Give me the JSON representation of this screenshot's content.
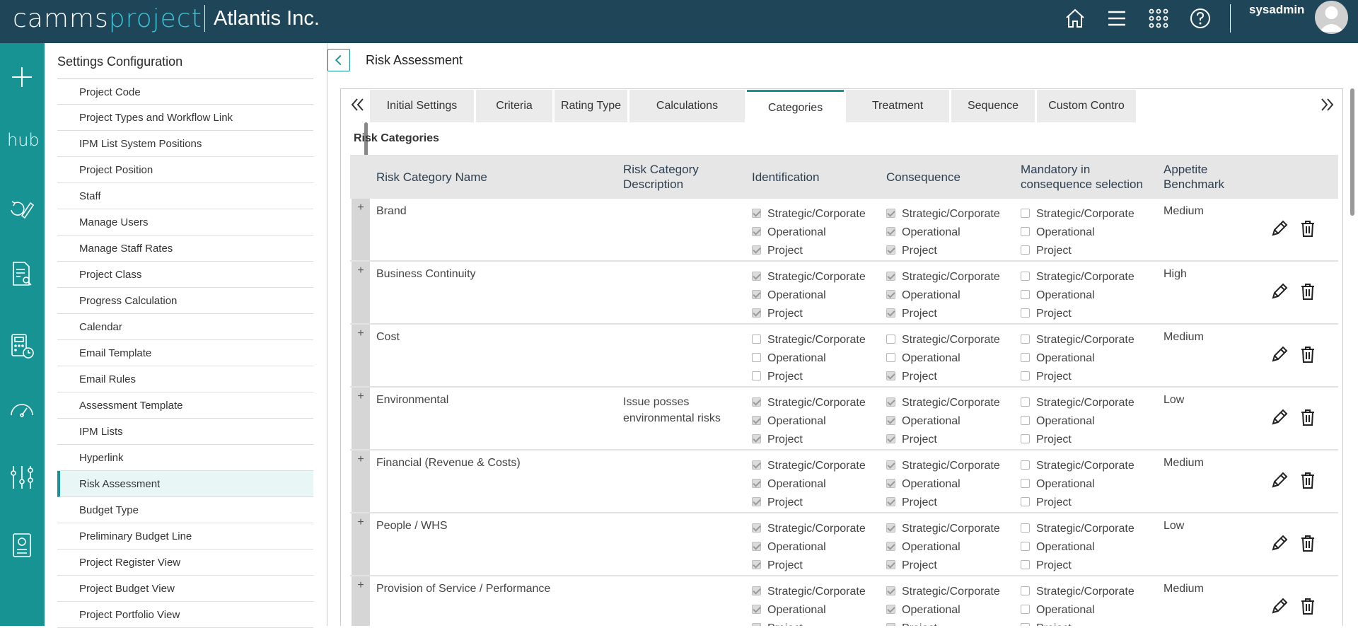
{
  "header": {
    "brand_part1": "camms",
    "brand_part2": "project",
    "company": "Atlantis Inc.",
    "username": "sysadmin",
    "icons": [
      "home-icon",
      "menu-icon",
      "apps-grid-icon",
      "help-icon"
    ]
  },
  "leftnav": {
    "items": [
      "add-icon",
      "hub-icon",
      "refresh-edit-icon",
      "document-search-icon",
      "calculator-clock-icon",
      "dashboard-gauge-icon",
      "settings-sliders-icon",
      "report-icon"
    ],
    "hub_label": "hub"
  },
  "settings": {
    "title": "Settings Configuration",
    "items": [
      {
        "label": "Project Code"
      },
      {
        "label": "Project Types and Workflow Link"
      },
      {
        "label": "IPM List System Positions"
      },
      {
        "label": "Project Position"
      },
      {
        "label": "Staff"
      },
      {
        "label": "Manage Users"
      },
      {
        "label": "Manage Staff Rates"
      },
      {
        "label": "Project Class"
      },
      {
        "label": "Progress Calculation"
      },
      {
        "label": "Calendar"
      },
      {
        "label": "Email Template"
      },
      {
        "label": "Email Rules"
      },
      {
        "label": "Assessment Template"
      },
      {
        "label": "IPM Lists"
      },
      {
        "label": "Hyperlink"
      },
      {
        "label": "Risk Assessment",
        "active": true
      },
      {
        "label": "Budget Type"
      },
      {
        "label": "Preliminary Budget Line"
      },
      {
        "label": "Project Register View"
      },
      {
        "label": "Project Budget View"
      },
      {
        "label": "Project Portfolio View"
      }
    ]
  },
  "main": {
    "title": "Risk Assessment",
    "tabs": [
      {
        "label": "Initial Settings"
      },
      {
        "label": "Criteria"
      },
      {
        "label": "Rating Type"
      },
      {
        "label": "Calculations"
      },
      {
        "label": "Categories",
        "active": true
      },
      {
        "label": "Treatment"
      },
      {
        "label": "Sequence"
      },
      {
        "label": "Custom Contro"
      }
    ],
    "section_title": "Risk Categories",
    "columns": {
      "name": "Risk Category Name",
      "desc_1": "Risk Category",
      "desc_2": "Description",
      "ident": "Identification",
      "conseq": "Consequence",
      "mand_1": "Mandatory in",
      "mand_2": "consequence selection",
      "bench_1": "Appetite",
      "bench_2": "Benchmark"
    },
    "option_labels": [
      "Strategic/Corporate",
      "Operational",
      "Project"
    ],
    "plus": "+",
    "rows": [
      {
        "name": "Brand",
        "desc": "",
        "ident": [
          true,
          true,
          true
        ],
        "conseq": [
          true,
          true,
          true
        ],
        "mand": [
          false,
          false,
          false
        ],
        "bench": "Medium"
      },
      {
        "name": "Business Continuity",
        "desc": "",
        "ident": [
          true,
          true,
          true
        ],
        "conseq": [
          true,
          true,
          true
        ],
        "mand": [
          false,
          false,
          false
        ],
        "bench": "High"
      },
      {
        "name": "Cost",
        "desc": "",
        "ident": [
          false,
          false,
          false
        ],
        "conseq": [
          false,
          false,
          true
        ],
        "mand": [
          false,
          false,
          false
        ],
        "bench": "Medium"
      },
      {
        "name": "Environmental",
        "desc": "Issue posses environmental risks",
        "ident": [
          true,
          true,
          true
        ],
        "conseq": [
          true,
          true,
          true
        ],
        "mand": [
          false,
          false,
          false
        ],
        "bench": "Low"
      },
      {
        "name": "Financial (Revenue & Costs)",
        "desc": "",
        "ident": [
          true,
          true,
          true
        ],
        "conseq": [
          true,
          true,
          true
        ],
        "mand": [
          false,
          false,
          false
        ],
        "bench": "Medium"
      },
      {
        "name": "People / WHS",
        "desc": "",
        "ident": [
          true,
          true,
          true
        ],
        "conseq": [
          true,
          true,
          true
        ],
        "mand": [
          false,
          false,
          false
        ],
        "bench": "Low"
      },
      {
        "name": "Provision of Service / Performance",
        "desc": "",
        "ident": [
          true,
          true,
          true
        ],
        "conseq": [
          true,
          true,
          true
        ],
        "mand": [
          false,
          false,
          false
        ],
        "bench": "Medium"
      }
    ]
  }
}
